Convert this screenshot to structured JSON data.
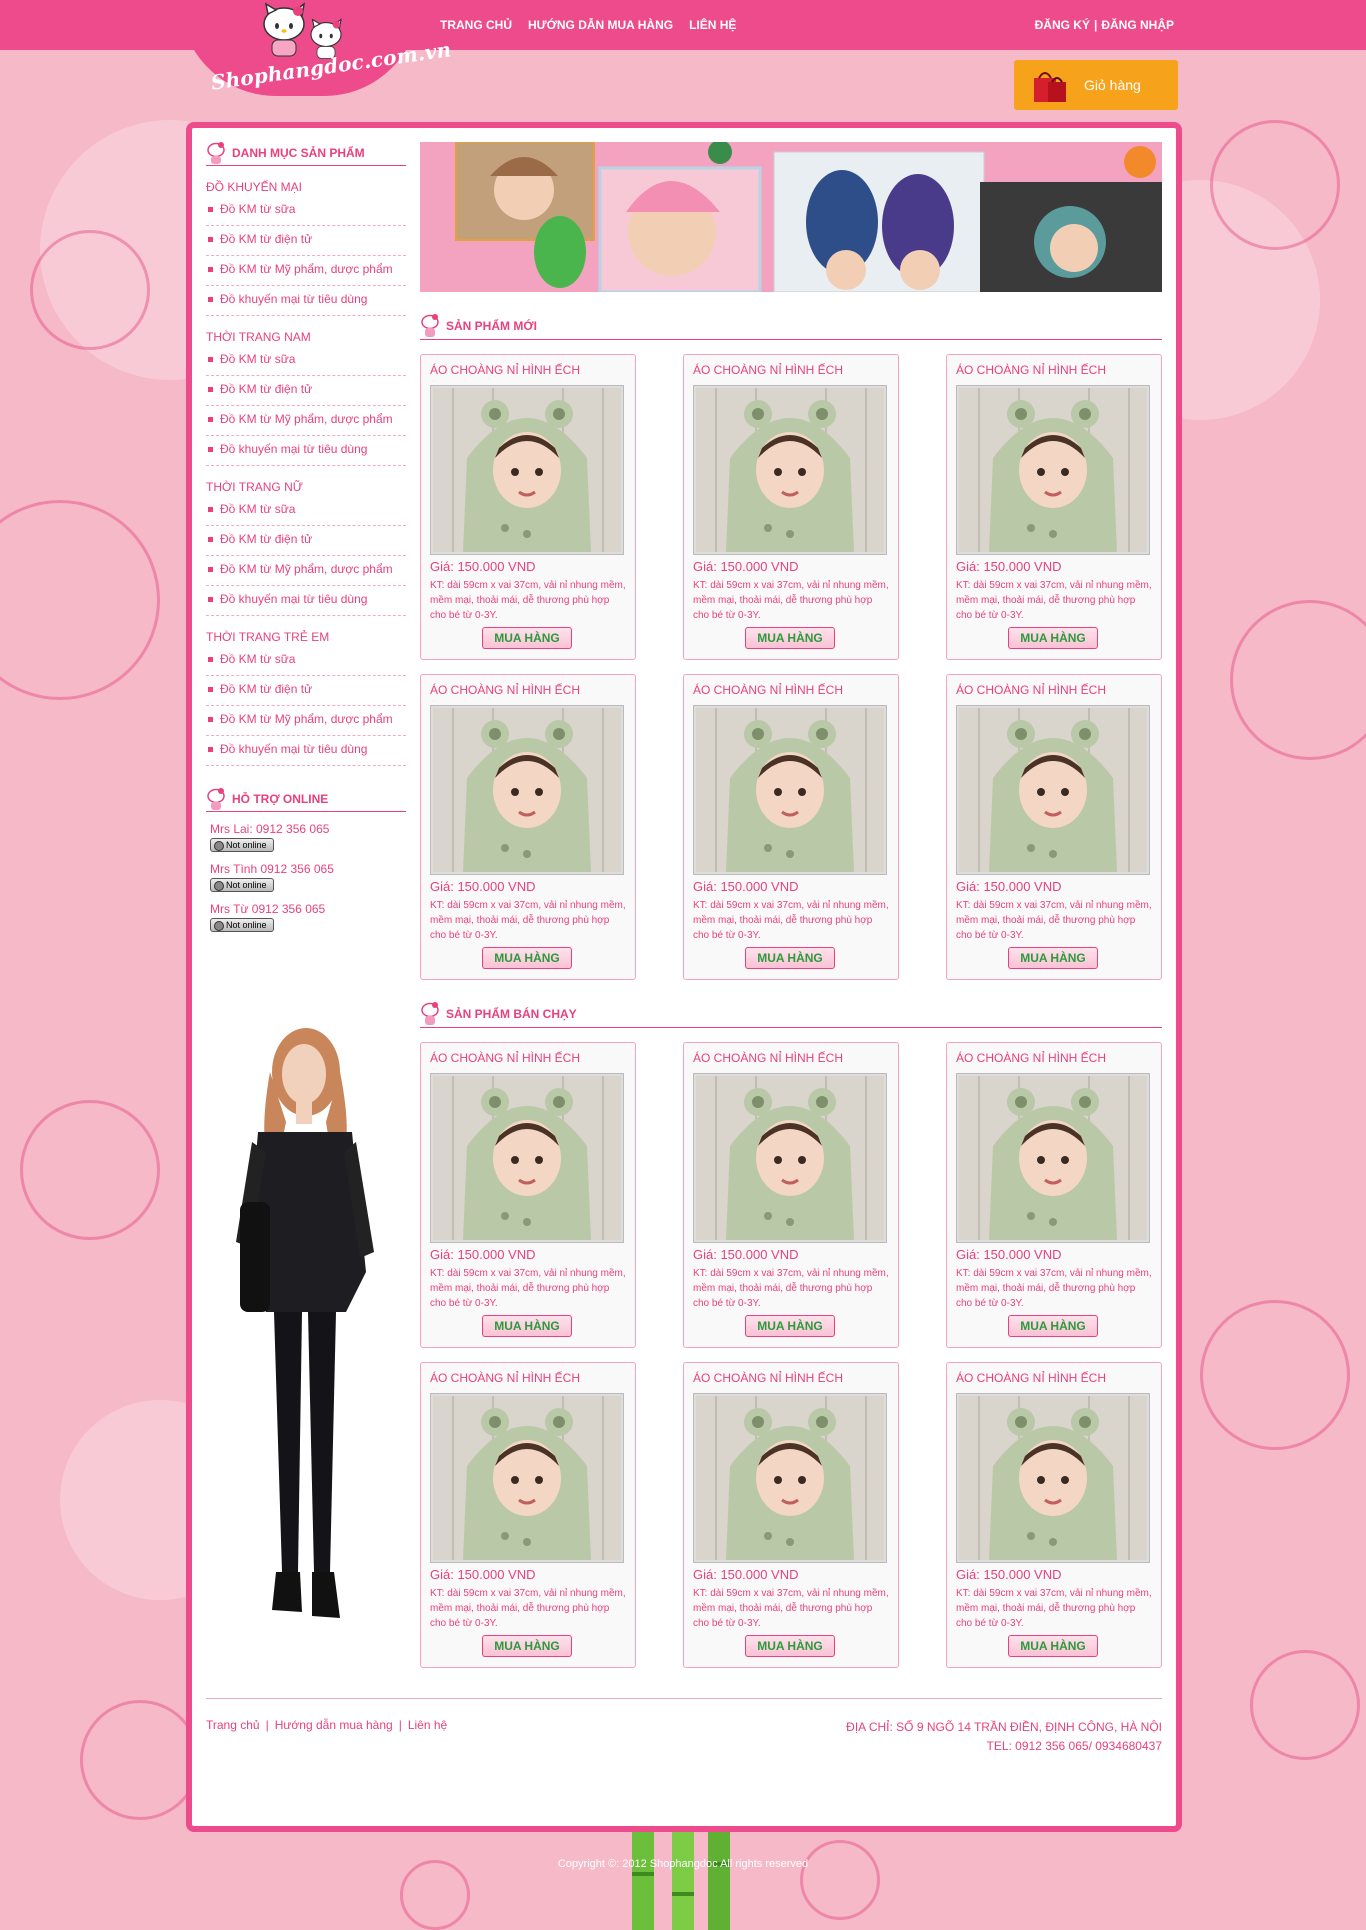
{
  "header": {
    "logo_text": "Shophangdoc.com.vn",
    "nav": [
      "TRANG CHỦ",
      "HƯỚNG DẪN MUA HÀNG",
      "LIÊN HỆ"
    ],
    "register": "ĐĂNG KÝ",
    "separator": "|",
    "login": "ĐĂNG NHẬP",
    "cart_label": "Giỏ hàng"
  },
  "sidebar": {
    "category_title": "DANH MỤC SẢN PHẨM",
    "groups": [
      {
        "title": "ĐỒ KHUYẾN MẠI",
        "items": [
          "Đồ KM từ sữa",
          "Đồ KM từ điện tử",
          "Đồ KM từ Mỹ phẩm, dược phẩm",
          "Đồ khuyến mại từ tiêu dùng"
        ]
      },
      {
        "title": "THỜI TRANG NAM",
        "items": [
          "Đồ KM từ sữa",
          "Đồ KM từ điện tử",
          "Đồ KM từ Mỹ phẩm, dược phẩm",
          "Đồ khuyến mại từ tiêu dùng"
        ]
      },
      {
        "title": "THỜI TRANG NỮ",
        "items": [
          "Đồ KM từ sữa",
          "Đồ KM từ điện tử",
          "Đồ KM từ Mỹ phẩm, dược phẩm",
          "Đồ khuyến mại từ tiêu dùng"
        ]
      },
      {
        "title": "THỜI TRANG TRẺ EM",
        "items": [
          "Đồ KM từ sữa",
          "Đồ KM từ điện tử",
          "Đồ KM từ Mỹ phẩm, dược phẩm",
          "Đồ khuyến mại từ tiêu dùng"
        ]
      }
    ],
    "support_title": "HỖ TRỢ ONLINE",
    "support": [
      {
        "name": "Mrs Lai: 0912 356 065",
        "status": "Not online"
      },
      {
        "name": "Mrs Tình 0912 356 065",
        "status": "Not online"
      },
      {
        "name": "Mrs Từ 0912 356 065",
        "status": "Not online"
      }
    ]
  },
  "sections": [
    {
      "title": "SẢN PHẨM MỚI",
      "products": [
        {
          "name": "ÁO CHOÀNG NỈ HÌNH ẾCH",
          "price": "Giá: 150.000 VND",
          "desc": "KT: dài 59cm x vai 37cm, vải nỉ nhung mềm, mềm mại, thoải mái, dễ thương phù hợp cho bé từ 0-3Y.",
          "button": "MUA HÀNG"
        },
        {
          "name": "ÁO CHOÀNG NỈ HÌNH ẾCH",
          "price": "Giá: 150.000 VND",
          "desc": "KT: dài 59cm x vai 37cm, vải nỉ nhung mềm, mềm mại, thoải mái, dễ thương phù hợp cho bé từ 0-3Y.",
          "button": "MUA HÀNG"
        },
        {
          "name": "ÁO CHOÀNG NỈ HÌNH ẾCH",
          "price": "Giá: 150.000 VND",
          "desc": "KT: dài 59cm x vai 37cm, vải nỉ nhung mềm, mềm mại, thoải mái, dễ thương phù hợp cho bé từ 0-3Y.",
          "button": "MUA HÀNG"
        },
        {
          "name": "ÁO CHOÀNG NỈ HÌNH ẾCH",
          "price": "Giá: 150.000 VND",
          "desc": "KT: dài 59cm x vai 37cm, vải nỉ nhung mềm, mềm mại, thoải mái, dễ thương phù hợp cho bé từ 0-3Y.",
          "button": "MUA HÀNG"
        },
        {
          "name": "ÁO CHOÀNG NỈ HÌNH ẾCH",
          "price": "Giá: 150.000 VND",
          "desc": "KT: dài 59cm x vai 37cm, vải nỉ nhung mềm, mềm mại, thoải mái, dễ thương phù hợp cho bé từ 0-3Y.",
          "button": "MUA HÀNG"
        },
        {
          "name": "ÁO CHOÀNG NỈ HÌNH ẾCH",
          "price": "Giá: 150.000 VND",
          "desc": "KT: dài 59cm x vai 37cm, vải nỉ nhung mềm, mềm mại, thoải mái, dễ thương phù hợp cho bé từ 0-3Y.",
          "button": "MUA HÀNG"
        }
      ]
    },
    {
      "title": "SẢN PHẨM BÁN CHẠY",
      "products": [
        {
          "name": "ÁO CHOÀNG NỈ HÌNH ẾCH",
          "price": "Giá: 150.000 VND",
          "desc": "KT: dài 59cm x vai 37cm, vải nỉ nhung mềm, mềm mại, thoải mái, dễ thương phù hợp cho bé từ 0-3Y.",
          "button": "MUA HÀNG"
        },
        {
          "name": "ÁO CHOÀNG NỈ HÌNH ẾCH",
          "price": "Giá: 150.000 VND",
          "desc": "KT: dài 59cm x vai 37cm, vải nỉ nhung mềm, mềm mại, thoải mái, dễ thương phù hợp cho bé từ 0-3Y.",
          "button": "MUA HÀNG"
        },
        {
          "name": "ÁO CHOÀNG NỈ HÌNH ẾCH",
          "price": "Giá: 150.000 VND",
          "desc": "KT: dài 59cm x vai 37cm, vải nỉ nhung mềm, mềm mại, thoải mái, dễ thương phù hợp cho bé từ 0-3Y.",
          "button": "MUA HÀNG"
        },
        {
          "name": "ÁO CHOÀNG NỈ HÌNH ẾCH",
          "price": "Giá: 150.000 VND",
          "desc": "KT: dài 59cm x vai 37cm, vải nỉ nhung mềm, mềm mại, thoải mái, dễ thương phù hợp cho bé từ 0-3Y.",
          "button": "MUA HÀNG"
        },
        {
          "name": "ÁO CHOÀNG NỈ HÌNH ẾCH",
          "price": "Giá: 150.000 VND",
          "desc": "KT: dài 59cm x vai 37cm, vải nỉ nhung mềm, mềm mại, thoải mái, dễ thương phù hợp cho bé từ 0-3Y.",
          "button": "MUA HÀNG"
        },
        {
          "name": "ÁO CHOÀNG NỈ HÌNH ẾCH",
          "price": "Giá: 150.000 VND",
          "desc": "KT: dài 59cm x vai 37cm, vải nỉ nhung mềm, mềm mại, thoải mái, dễ thương phù hợp cho bé từ 0-3Y.",
          "button": "MUA HÀNG"
        }
      ]
    }
  ],
  "footer": {
    "links": [
      "Trang chủ",
      "Hướng dẫn mua hàng",
      "Liên hệ"
    ],
    "link_separator": "|",
    "address": "ĐỊA CHỈ: SỐ 9 NGÕ 14 TRẦN ĐIỀN, ĐỊNH CÔNG, HÀ NỘI",
    "tel": "TEL: 0912 356 065/ 0934680437",
    "copyright": "Copyright ©: 2012 Shophangdoc All rights reserved"
  },
  "colors": {
    "brand_pink": "#ed4b8c",
    "text_pink": "#e8417e",
    "cart_orange": "#f7a21b",
    "buy_green": "#2a9b3b"
  }
}
